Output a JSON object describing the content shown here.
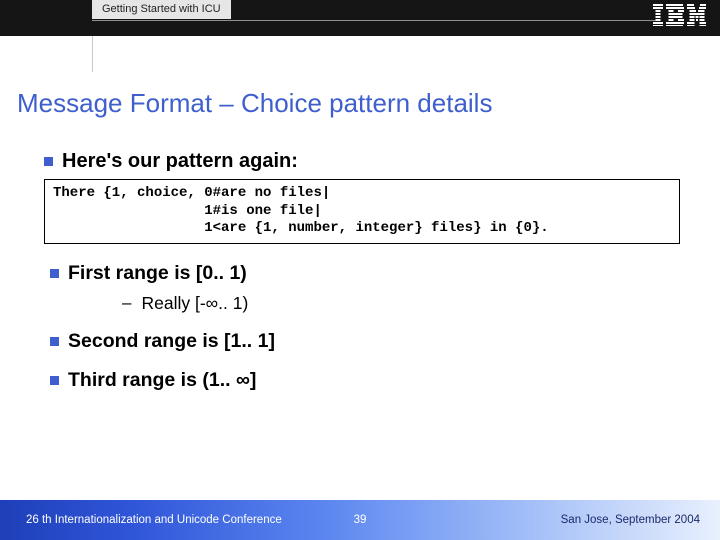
{
  "header": {
    "tab_label": "Getting Started with ICU",
    "logo_name": "IBM"
  },
  "title": "Message Format – Choice pattern details",
  "bullets": {
    "intro": "Here's our pattern again:",
    "code": "There {1, choice, 0#are no files|\n                  1#is one file|\n                  1<are {1, number, integer} files} in {0}.",
    "first": "First range is [0.. 1)",
    "first_sub": "Really [-∞.. 1)",
    "second": "Second range is [1.. 1]",
    "third": "Third range is (1.. ∞]"
  },
  "footer": {
    "left": "26 th Internationalization and Unicode Conference",
    "page": "39",
    "right": "San Jose, September 2004"
  }
}
